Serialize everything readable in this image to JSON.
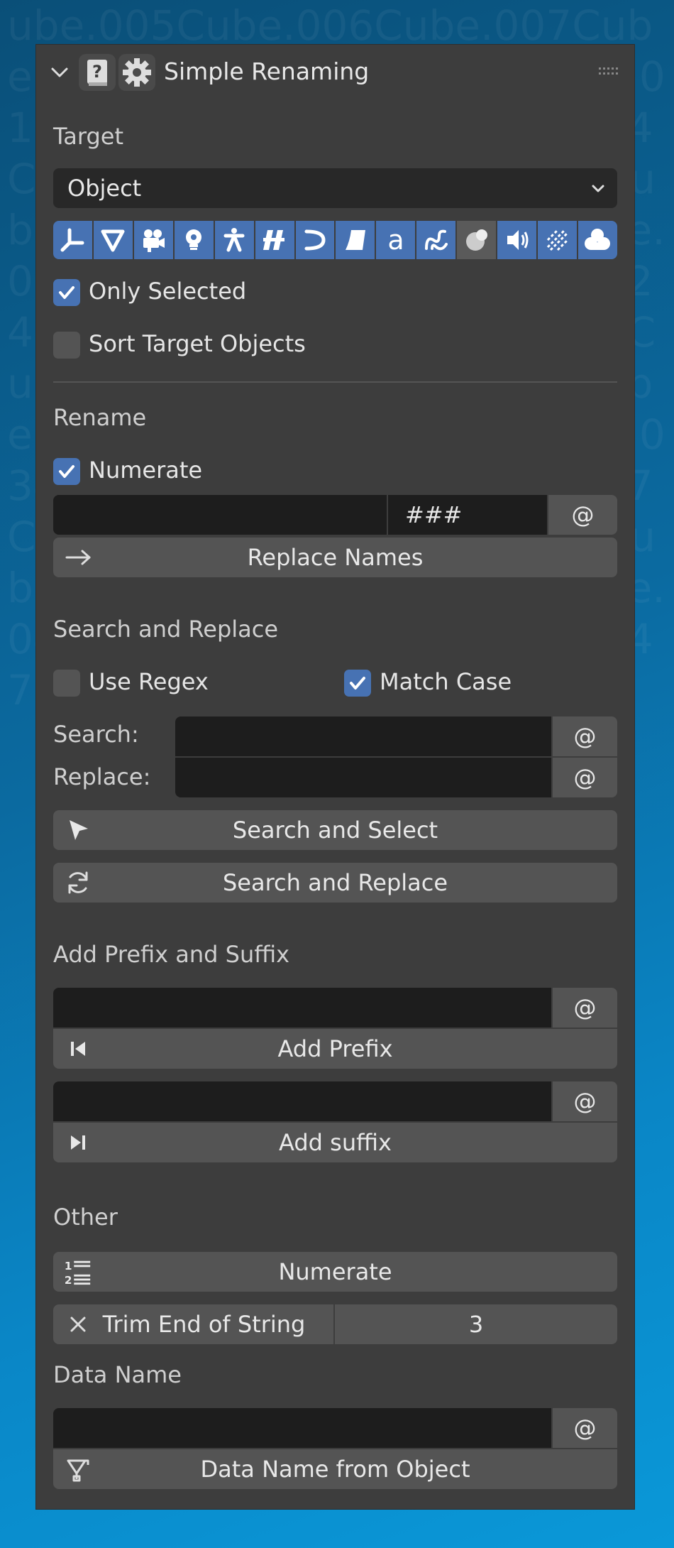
{
  "panel": {
    "title": "Simple Renaming"
  },
  "target": {
    "heading": "Target",
    "dropdown_value": "Object",
    "type_icons": [
      "empty-axes-icon",
      "mesh-icon",
      "camera-icon",
      "light-icon",
      "armature-icon",
      "grease-pencil-icon",
      "curve-icon",
      "surface-icon",
      "text-icon",
      "metaball-icon",
      "material-icon",
      "speaker-icon",
      "particles-icon",
      "volume-icon"
    ],
    "only_selected_label": "Only Selected",
    "only_selected_checked": true,
    "sort_label": "Sort Target Objects",
    "sort_checked": false
  },
  "rename": {
    "heading": "Rename",
    "numerate_label": "Numerate",
    "numerate_checked": true,
    "name_value": "",
    "pattern_value": "###",
    "at_label": "@",
    "replace_button": "Replace Names"
  },
  "search_replace": {
    "heading": "Search and Replace",
    "regex_label": "Use Regex",
    "regex_checked": false,
    "match_case_label": "Match Case",
    "match_case_checked": true,
    "search_label": "Search:",
    "replace_label": "Replace:",
    "at_label": "@",
    "search_select_button": "Search and Select",
    "search_replace_button": "Search and Replace"
  },
  "prefix_suffix": {
    "heading": "Add Prefix and Suffix",
    "at_label": "@",
    "prefix_button": "Add Prefix",
    "suffix_button": "Add suffix"
  },
  "other": {
    "heading": "Other",
    "numerate_button": "Numerate",
    "trim_label": "Trim End of String",
    "trim_value": "3"
  },
  "data_name": {
    "heading": "Data Name",
    "at_label": "@",
    "from_object_button": "Data Name from Object"
  },
  "colors": {
    "panel_bg": "#3d3d3d",
    "field_bg": "#1d1d1d",
    "button_bg": "#545454",
    "accent": "#4772b3"
  }
}
